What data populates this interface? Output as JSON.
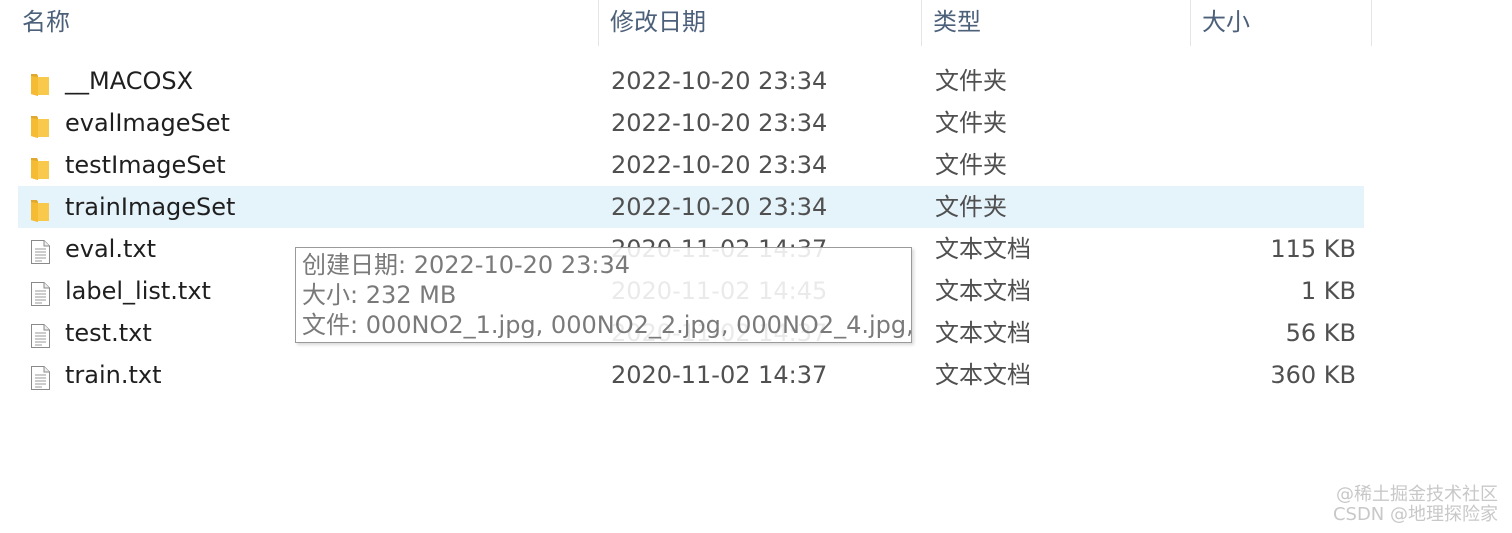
{
  "columns": {
    "name": "名称",
    "modified": "修改日期",
    "type": "类型",
    "size": "大小"
  },
  "files": [
    {
      "name": "__MACOSX",
      "modified": "2022-10-20 23:34",
      "type": "文件夹",
      "size": "",
      "icon": "folder-icon",
      "selected": false
    },
    {
      "name": "evalImageSet",
      "modified": "2022-10-20 23:34",
      "type": "文件夹",
      "size": "",
      "icon": "folder-icon",
      "selected": false
    },
    {
      "name": "testImageSet",
      "modified": "2022-10-20 23:34",
      "type": "文件夹",
      "size": "",
      "icon": "folder-icon",
      "selected": false
    },
    {
      "name": "trainImageSet",
      "modified": "2022-10-20 23:34",
      "type": "文件夹",
      "size": "",
      "icon": "folder-icon",
      "selected": true
    },
    {
      "name": "eval.txt",
      "modified": "2020-11-02 14:37",
      "type": "文本文档",
      "size": "115 KB",
      "icon": "text-file-icon",
      "selected": false
    },
    {
      "name": "label_list.txt",
      "modified": "2020-11-02 14:45",
      "type": "文本文档",
      "size": "1 KB",
      "icon": "text-file-icon",
      "selected": false
    },
    {
      "name": "test.txt",
      "modified": "2020-11-02 14:37",
      "type": "文本文档",
      "size": "56 KB",
      "icon": "text-file-icon",
      "selected": false
    },
    {
      "name": "train.txt",
      "modified": "2020-11-02 14:37",
      "type": "文本文档",
      "size": "360 KB",
      "icon": "text-file-icon",
      "selected": false
    }
  ],
  "tooltip": {
    "created": "创建日期: 2022-10-20 23:34",
    "size": "大小: 232 MB",
    "files": "文件: 000NO2_1.jpg, 000NO2_2.jpg, 000NO2_4.jpg, ..."
  },
  "watermark": {
    "line1": "@稀土掘金技术社区",
    "line2": "CSDN @地理探险家"
  },
  "colors": {
    "selection": "#e5f3fb",
    "folder": "#f8c94a",
    "header_text": "#4c607a"
  }
}
